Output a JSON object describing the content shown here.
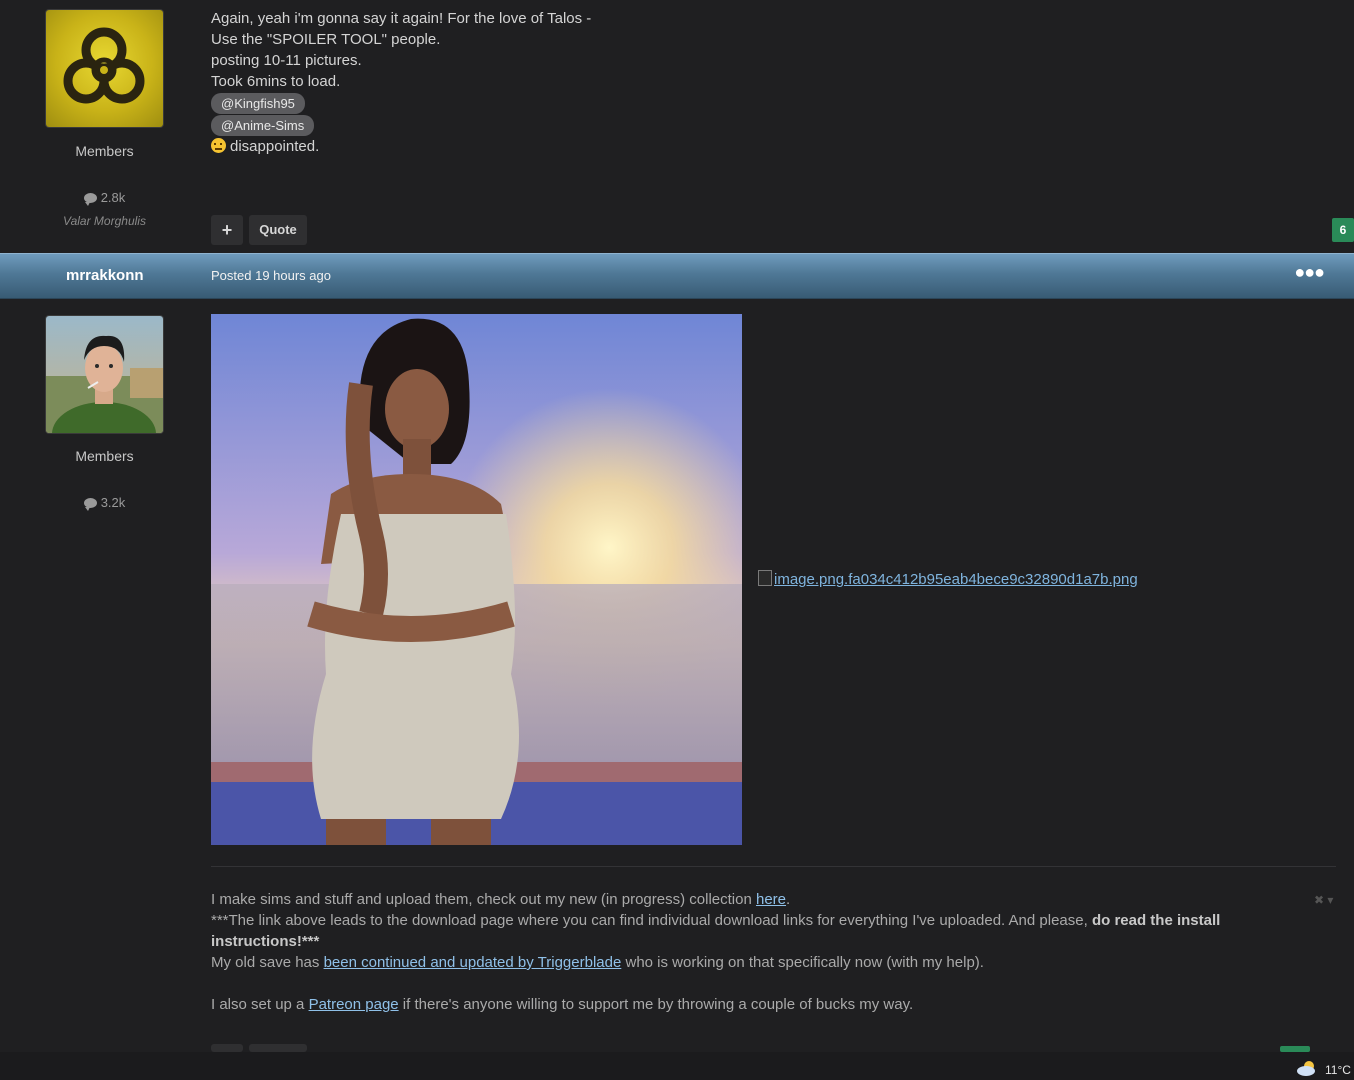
{
  "post1": {
    "avatar_icon": "biohazard-icon",
    "group": "Members",
    "post_count": "2.8k",
    "tagline": "Valar Morghulis",
    "lines": [
      "Again, yeah i'm gonna say it again! For the love of Talos -",
      "Use the \"SPOILER TOOL\" people.",
      "posting 10-11 pictures.",
      "Took 6mins to load."
    ],
    "mentions": [
      "@Kingfish95",
      "@Anime-Sims"
    ],
    "reaction_text": "disappointed.",
    "plus_label": "+",
    "quote_label": "Quote",
    "reputation": "6"
  },
  "post2": {
    "author": "mrrakkonn",
    "posted": "Posted 19 hours ago",
    "menu_icon": "more-dots-icon",
    "group": "Members",
    "post_count": "3.2k",
    "broken_image_alt": "image.png.fa034c412b95eab4bece9c32890d1a7b.png",
    "signature": {
      "line1_before": "I make sims and stuff and upload them, check out my new (in progress) collection ",
      "line1_link": "here",
      "line1_after": ".",
      "line2_before": "***The link above leads to the download page where you can find individual download links for everything I've uploaded. And please, ",
      "line2_bold": "do read the install instructions!***",
      "line3_before": "My old save has ",
      "line3_link": "been continued and updated by Triggerblade",
      "line3_after": " who is working on that specifically now (with my help).",
      "line4_before": "I also set up a ",
      "line4_link": "Patreon page",
      "line4_after": " if there's anyone willing to support me by throwing a couple of bucks my way."
    }
  },
  "taskbar": {
    "weather_icon": "partly-cloudy-icon",
    "temperature": "11°C"
  },
  "colors": {
    "background": "#1f1f21",
    "postbar": "#4f7896",
    "reputation_green": "#2a8a58",
    "link": "#8fc0e8"
  }
}
